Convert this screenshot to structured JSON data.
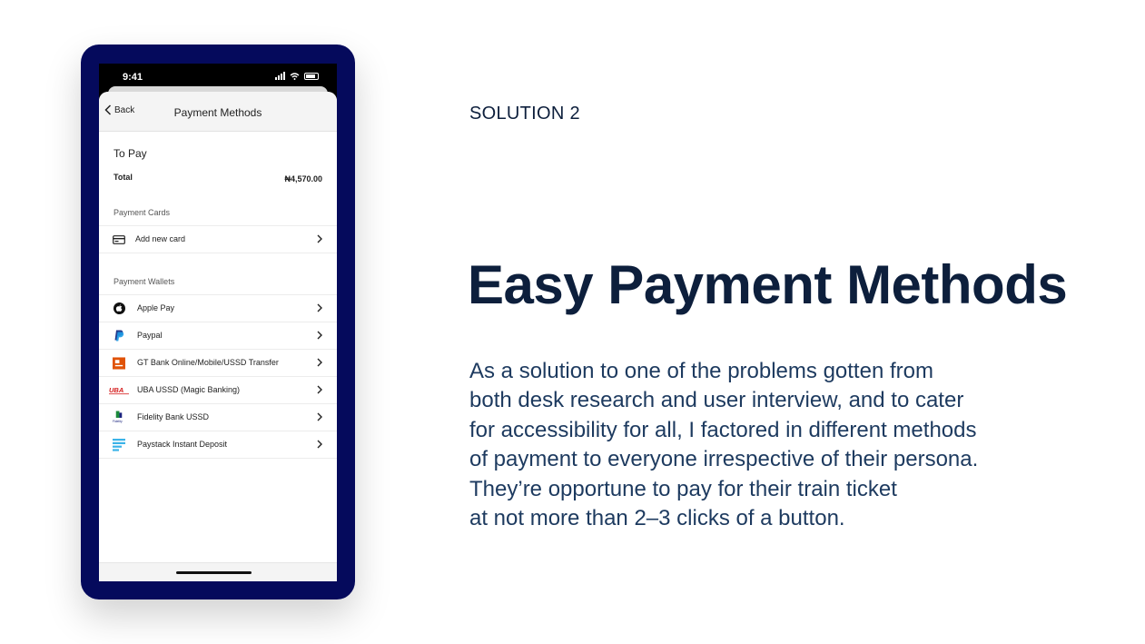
{
  "phone": {
    "status_time": "9:41",
    "nav": {
      "back_label": "Back",
      "title": "Payment Methods"
    },
    "summary": {
      "to_pay": "To Pay",
      "total_label": "Total",
      "total_value": "₦4,570.00"
    },
    "payment_cards": {
      "heading": "Payment Cards",
      "add_card_label": "Add new card"
    },
    "payment_wallets": {
      "heading": "Payment Wallets",
      "items": [
        {
          "label": "Apple Pay",
          "icon": "apple-icon"
        },
        {
          "label": "Paypal",
          "icon": "paypal-icon"
        },
        {
          "label": "GT Bank Online/Mobile/USSD Transfer",
          "icon": "gtbank-logo"
        },
        {
          "label": "UBA USSD (Magic Banking)",
          "icon": "uba-logo",
          "logo_text": "UBA"
        },
        {
          "label": "Fidelity Bank USSD",
          "icon": "fidelity-logo",
          "logo_text": "Fidelity"
        },
        {
          "label": "Paystack Instant Deposit",
          "icon": "paystack-logo"
        }
      ]
    }
  },
  "slide": {
    "kicker": "SOLUTION 2",
    "headline": "Easy Payment Methods",
    "body_lines": [
      "As a solution to one of the problems gotten from",
      "both desk research and user interview, and to cater",
      "for accessibility for all, I factored in different methods",
      "of payment to everyone irrespective of their persona.",
      "They’re opportune to pay for their train ticket",
      "at not more than 2–3 clicks of a button."
    ]
  },
  "colors": {
    "phone_frame": "#050a5c",
    "text_dark": "#0d1f3c",
    "body_text": "#1d3a5f"
  }
}
